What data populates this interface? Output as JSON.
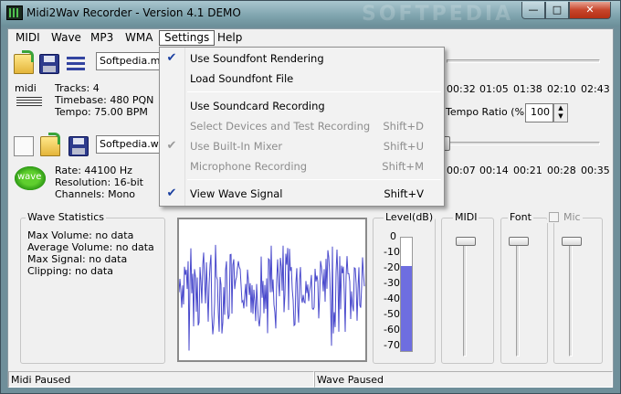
{
  "window": {
    "title": "Midi2Wav Recorder - Version 4.1 DEMO",
    "watermark": "SOFTPEDIA",
    "min_glyph": "—",
    "max_glyph": "□",
    "close_glyph": "✕"
  },
  "menubar": [
    "MIDI",
    "Wave",
    "MP3",
    "WMA",
    "Settings",
    "Help"
  ],
  "settings_menu": {
    "items": [
      {
        "label": "Use Soundfont Rendering",
        "shortcut": "",
        "checked": true,
        "disabled": false
      },
      {
        "label": "Load Soundfont File",
        "shortcut": "",
        "checked": false,
        "disabled": false
      },
      {
        "label": "Use Soundcard Recording",
        "shortcut": "",
        "checked": false,
        "disabled": false
      },
      {
        "label": "Select Devices and Test Recording",
        "shortcut": "Shift+D",
        "checked": false,
        "disabled": true
      },
      {
        "label": "Use Built-In Mixer",
        "shortcut": "Shift+U",
        "checked": true,
        "disabled": true
      },
      {
        "label": "Microphone Recording",
        "shortcut": "Shift+M",
        "checked": false,
        "disabled": true
      },
      {
        "label": "View Wave Signal",
        "shortcut": "Shift+V",
        "checked": true,
        "disabled": false
      }
    ]
  },
  "midi": {
    "file": "Softpedia.mid",
    "icon_label": "midi",
    "tracks": "Tracks: 4",
    "timebase": "Timebase: 480 PQN",
    "tempo": "Tempo: 75.00 BPM",
    "time_ticks": [
      "00:32",
      "01:05",
      "01:38",
      "02:10",
      "02:43"
    ],
    "tempo_ratio_label": "Tempo Ratio (%):",
    "tempo_ratio_value": "100"
  },
  "wave": {
    "file": "Softpedia.wav",
    "icon_label": "wave",
    "rate": "Rate: 44100 Hz",
    "resolution": "Resolution: 16-bit",
    "channels": "Channels: Mono",
    "time_ticks": [
      "00:07",
      "00:14",
      "00:21",
      "00:28",
      "00:35"
    ]
  },
  "stats": {
    "title": "Wave Statistics",
    "max_volume": "Max Volume: no data",
    "avg_volume": "Average Volume: no data",
    "max_signal": "Max Signal: no data",
    "clipping": "Clipping: no data"
  },
  "level": {
    "title": "Level(dB)",
    "ticks": [
      "0",
      "-10",
      "-20",
      "-30",
      "-40",
      "-50",
      "-60",
      "-70"
    ],
    "fill_fraction": 0.75
  },
  "mixer": {
    "midi_label": "MIDI",
    "font_label": "Font",
    "mic_label": "Mic"
  },
  "statusbar": {
    "left": "Midi Paused",
    "right": "Wave Paused"
  }
}
